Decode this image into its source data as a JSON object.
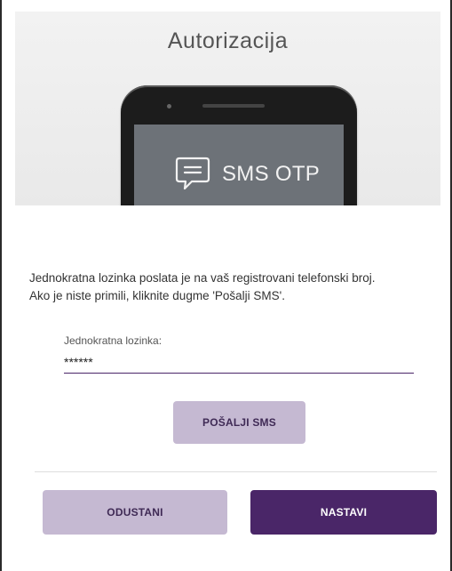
{
  "header": {
    "title": "Autorizacija",
    "illustration_text": "SMS OTP"
  },
  "info": {
    "line1": "Jednokratna lozinka poslata je na vaš registrovani telefonski broj.",
    "line2": "Ako je niste primili, kliknite dugme 'Pošalji SMS'."
  },
  "otp": {
    "label": "Jednokratna lozinka:",
    "value": "******"
  },
  "buttons": {
    "send_sms": "POŠALJI SMS",
    "cancel": "ODUSTANI",
    "continue": "NASTAVI"
  },
  "colors": {
    "accent": "#4a2668",
    "secondary_button": "#c5b9d2"
  }
}
